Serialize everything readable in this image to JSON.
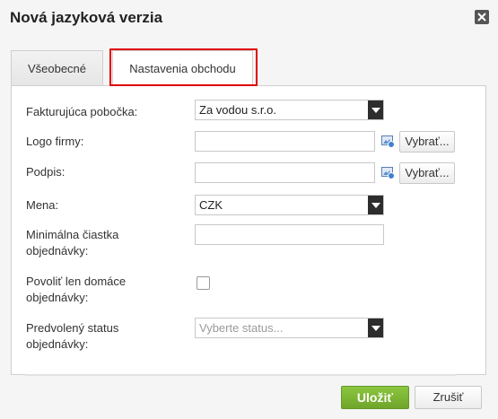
{
  "dialog": {
    "title": "Nová jazyková verzia"
  },
  "tabs": [
    {
      "label": "Všeobecné"
    },
    {
      "label": "Nastavenia obchodu"
    }
  ],
  "form": {
    "billing_branch": {
      "label": "Fakturujúca pobočka:",
      "value": "Za vodou s.r.o."
    },
    "company_logo": {
      "label": "Logo firmy:",
      "value": "",
      "button": "Vybrať..."
    },
    "signature": {
      "label": "Podpis:",
      "value": "",
      "button": "Vybrať..."
    },
    "currency": {
      "label": "Mena:",
      "value": "CZK"
    },
    "min_order": {
      "label_line1": "Minimálna čiastka",
      "label_line2": "objednávky:",
      "value": ""
    },
    "domestic_only": {
      "label_line1": "Povoliť len domáce",
      "label_line2": "objednávky:",
      "checked": false
    },
    "default_status": {
      "label_line1": "Predvolený status",
      "label_line2": "objednávky:",
      "placeholder": "Vyberte status..."
    }
  },
  "footer": {
    "save_label": "Uložiť",
    "cancel_label": "Zrušiť"
  },
  "colors": {
    "accent": "#7ab535",
    "highlight": "#e00000"
  }
}
